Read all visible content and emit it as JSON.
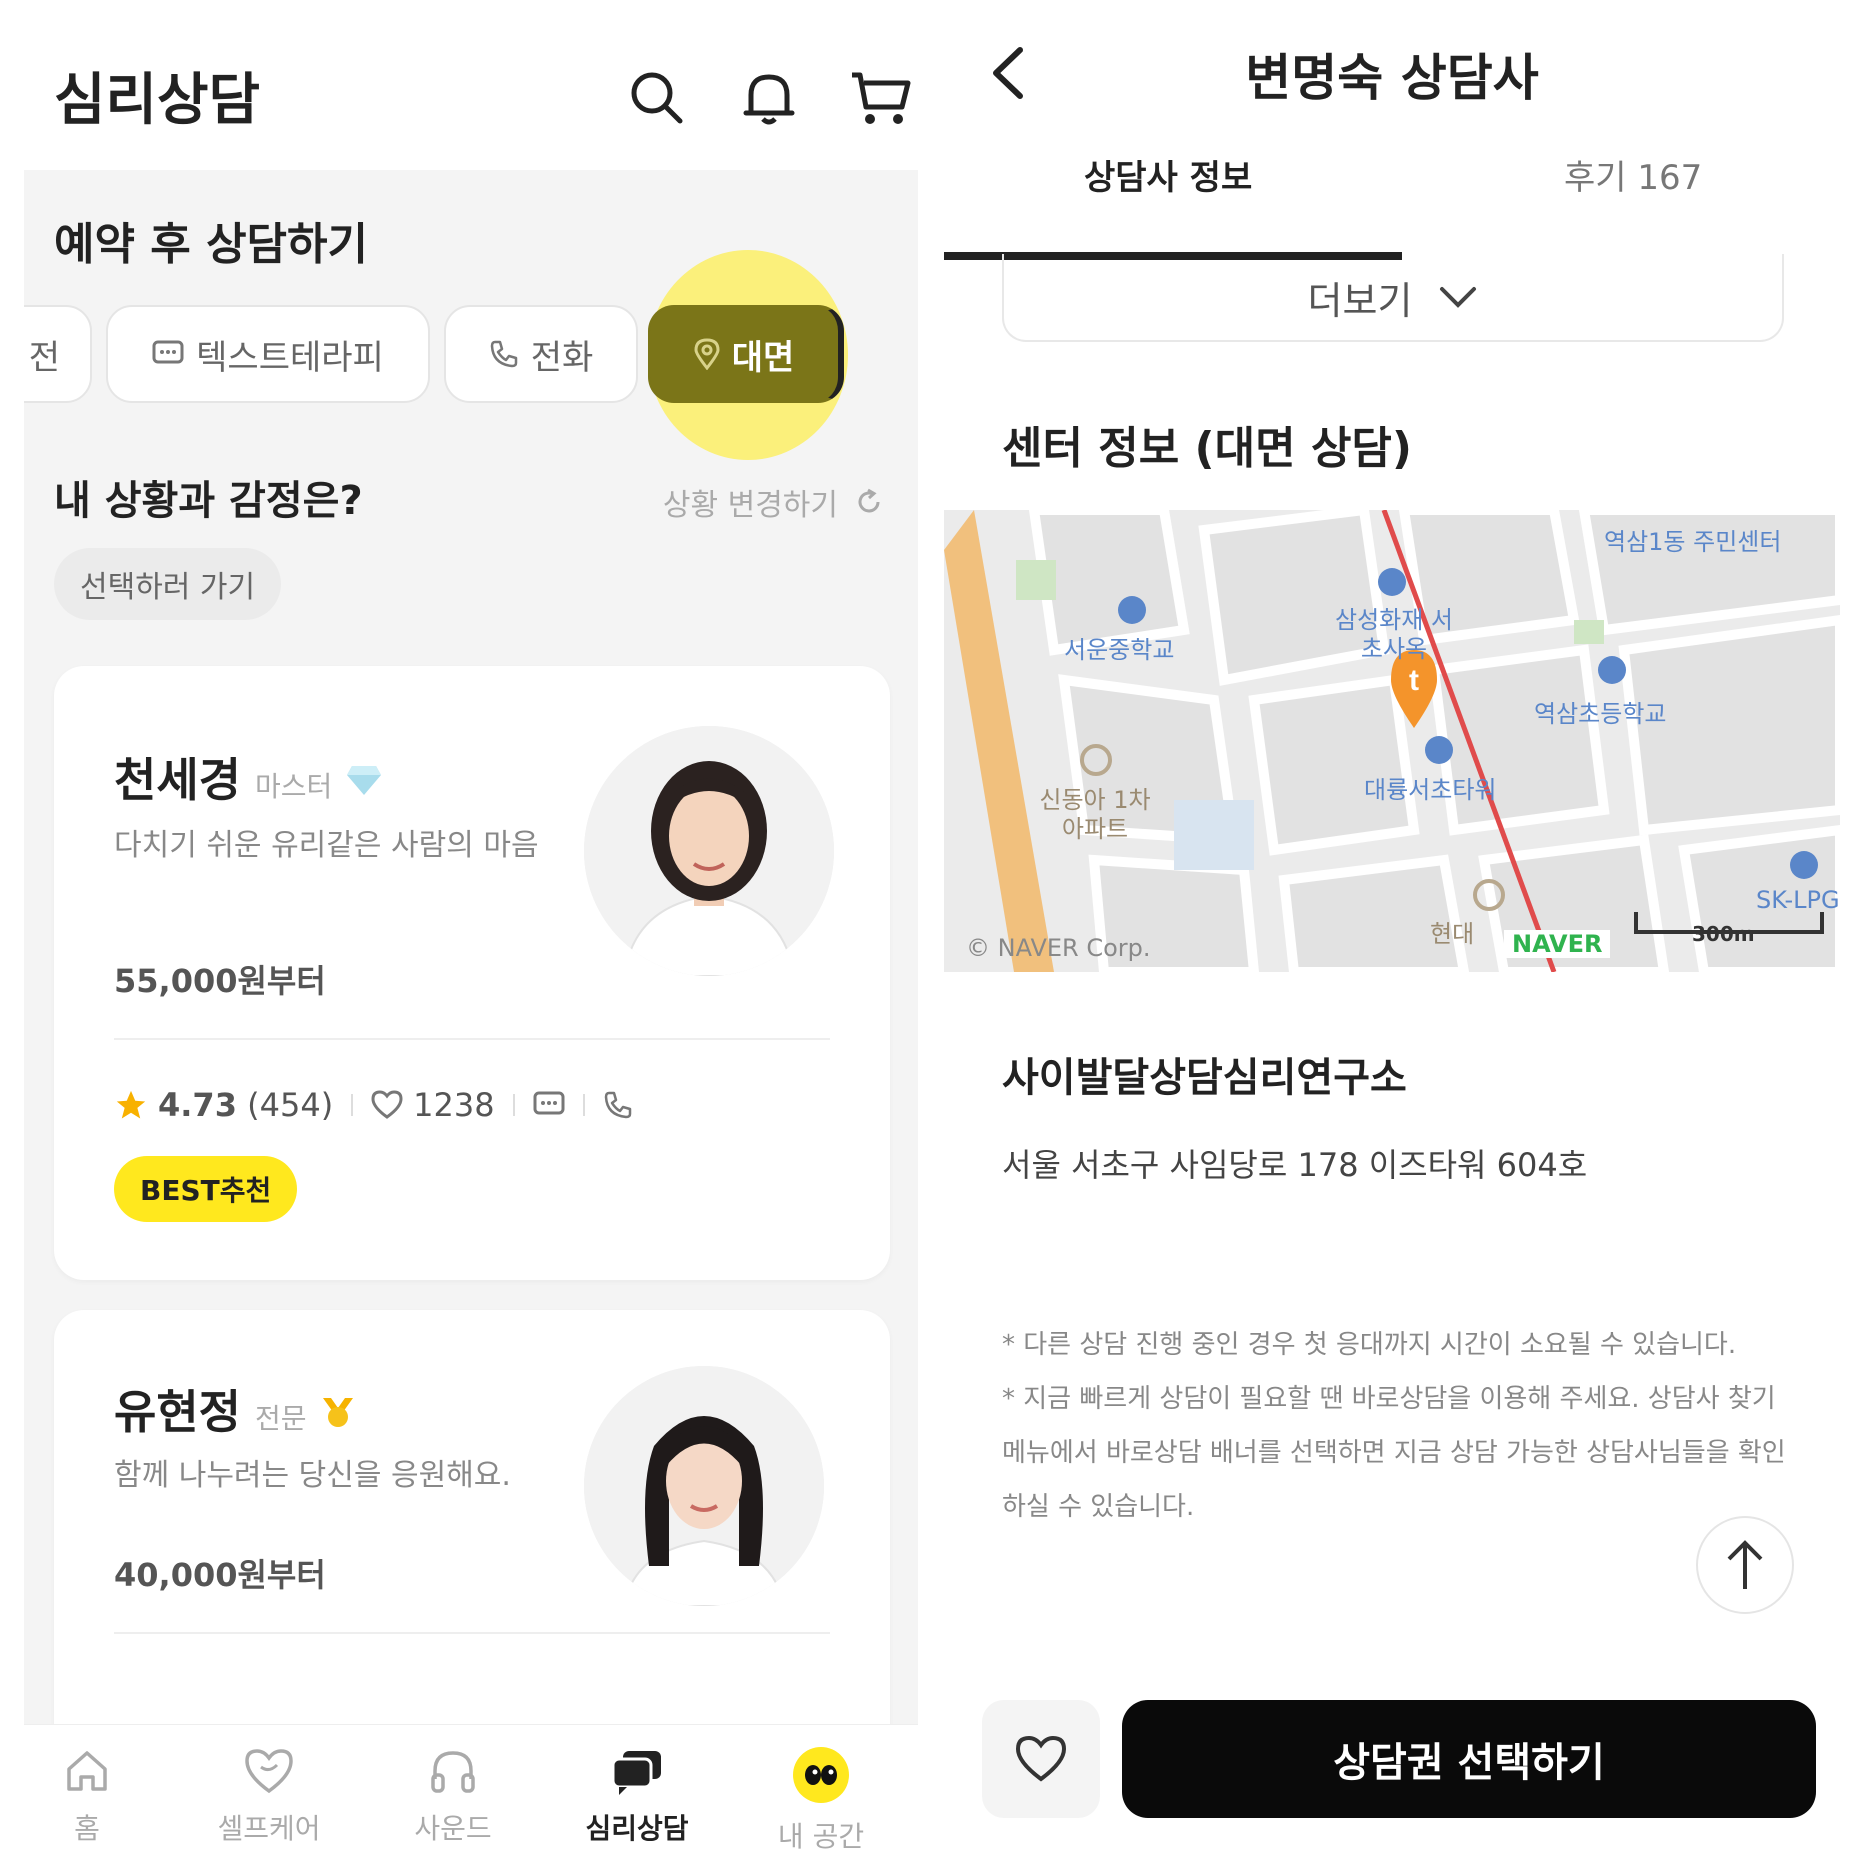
{
  "left": {
    "header": {
      "title": "심리상담"
    },
    "reserve_section": {
      "title": "예약 후 상담하기"
    },
    "chips": [
      {
        "label": "전",
        "icon": "partial-chip"
      },
      {
        "label": "텍스트테라피",
        "icon": "chat-icon"
      },
      {
        "label": "전화",
        "icon": "phone-icon"
      },
      {
        "label": "대면",
        "icon": "location-pin-icon",
        "active": true
      }
    ],
    "situation": {
      "title": "내 상황과 감정은?",
      "change_link": "상황 변경하기",
      "select_button": "선택하러 가기"
    },
    "counselors": [
      {
        "name": "천세경",
        "grade": "마스터",
        "grade_icon": "diamond-icon",
        "bio": "다치기 쉬운 유리같은 사람의 마음",
        "price": "55,000원부터",
        "rating": "4.73",
        "review_count": "(454)",
        "likes": "1238",
        "badge": "BEST추천"
      },
      {
        "name": "유현정",
        "grade": "전문",
        "grade_icon": "medal-icon",
        "bio": "함께 나누려는 당신을 응원해요.",
        "price": "40,000원부터"
      }
    ],
    "bottom_nav": [
      {
        "label": "홈",
        "icon": "home-icon"
      },
      {
        "label": "셀프케어",
        "icon": "heart-care-icon"
      },
      {
        "label": "사운드",
        "icon": "headphones-icon"
      },
      {
        "label": "심리상담",
        "icon": "chat-bubbles-icon",
        "active": true
      },
      {
        "label": "내 공간",
        "icon": "eyes-icon"
      }
    ],
    "colors": {
      "active_chip": "#7b7518",
      "highlight": "#fbf07b",
      "badge": "#ffe81e"
    }
  },
  "right": {
    "header": {
      "title": "변명숙 상담사"
    },
    "tabs": [
      {
        "label": "상담사 정보",
        "active": true
      },
      {
        "label": "후기 167"
      }
    ],
    "more_label": "더보기",
    "center_section": {
      "title": "센터 정보 (대면 상담)"
    },
    "map": {
      "labels": [
        "역삼1동 주민센터",
        "삼성화재 서초사옥",
        "서운중학교",
        "역삼초등학교",
        "신동아 1차아파트",
        "대륭서초타워",
        "SK-LPG",
        "현대"
      ],
      "credit": "© NAVER Corp.",
      "logo": "NAVER",
      "scale": "300m"
    },
    "org_name": "사이발달상담심리연구소",
    "address": "서울 서초구 사임당로 178 이즈타워 604호",
    "notices": [
      "* 다른 상담 진행 중인 경우 첫 응대까지 시간이 소요될 수 있습니다.",
      "* 지금 빠르게 상담이 필요할 땐 바로상담을 이용해 주세요. 상담사 찾기 메뉴에서 바로상담 배너를 선택하면 지금 상담 가능한 상담사님들을 확인하실 수 있습니다."
    ],
    "cta_label": "상담권 선택하기"
  }
}
